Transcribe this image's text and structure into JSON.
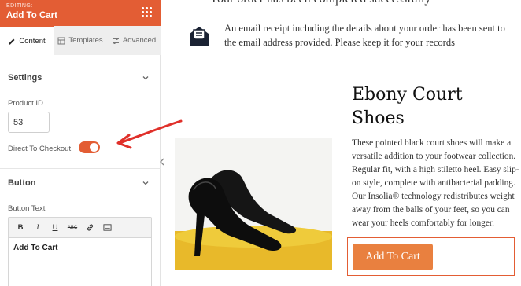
{
  "panel": {
    "editing_label": "EDITING:",
    "title": "Add To Cart",
    "tabs": [
      {
        "label": "Content",
        "icon": "pencil-icon",
        "active": true
      },
      {
        "label": "Templates",
        "icon": "templates-icon",
        "active": false
      },
      {
        "label": "Advanced",
        "icon": "sliders-icon",
        "active": false
      }
    ],
    "settings": {
      "heading": "Settings",
      "product_id_label": "Product ID",
      "product_id_value": "53",
      "direct_checkout_label": "Direct To Checkout",
      "direct_checkout_on": true
    },
    "button_section": {
      "heading": "Button",
      "button_text_label": "Button Text",
      "toolbar": [
        "B",
        "I",
        "U",
        "ABC",
        "link-icon",
        "image-icon"
      ],
      "editor_value": "Add To Cart"
    }
  },
  "preview": {
    "top_partial_text": "Your order has been completed successfully",
    "receipt_text": "An email receipt including the details about your order has been sent to the email address provided. Please keep it for your records",
    "product_title": "Ebony Court Shoes",
    "product_description": "These pointed black court shoes will make a versatile addition to your footwear collection. Regular fit, with a high stiletto heel. Easy slip-on style, complete with antibacterial padding. Our Insolia® technology redistributes weight away from the balls of your feet, so you can wear your heels comfortably for longer.",
    "cta_label": "Add To Cart"
  },
  "colors": {
    "accent": "#e35d34",
    "cta": "#e9803f",
    "annotation": "#e0302a"
  }
}
